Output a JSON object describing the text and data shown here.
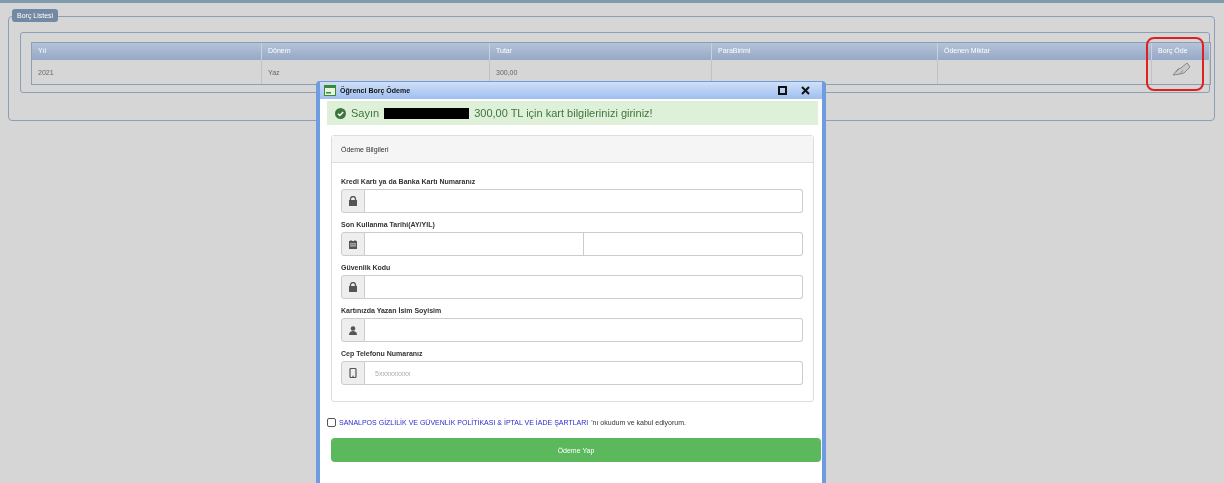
{
  "debt_list": {
    "legend": "Borç Listesi",
    "table": {
      "columns": [
        "Yıl",
        "Dönem",
        "Tutar",
        "ParaBirimi",
        "Ödenen Miktar",
        "Borç Öde"
      ],
      "rows": [
        {
          "cells": [
            "2021",
            "Yaz",
            "300,00",
            "",
            ""
          ],
          "highlighted": true
        }
      ]
    }
  },
  "dialog": {
    "title": "Öğrenci Borç Ödeme",
    "alert": {
      "greeting": "Sayın",
      "redacted": true,
      "message": "300,00 TL için kart bilgilerinizi giriniz!"
    },
    "panel_title": "Ödeme Bilgileri",
    "fields": [
      {
        "label": "Kredi Kartı ya da Banka Kartı Numaranız",
        "kind": "single"
      },
      {
        "label": "Son Kullanma Tarihi(AY/YIL)",
        "kind": "pair"
      },
      {
        "label": "Güvenlik Kodu",
        "kind": "single"
      },
      {
        "label": "Kartınızda Yazan İsim Soyisim",
        "kind": "single"
      },
      {
        "label": "Cep Telefonu Numaranız",
        "kind": "single",
        "placeholder": "5xxxxxxxxx"
      }
    ],
    "agreement": {
      "checked": false,
      "link": "SANALPOS GİZLİLİK VE GÜVENLİK POLİTİKASI & İPTAL VE İADE ŞARTLARI",
      "text": "'nı okudum ve kabul ediyorum."
    },
    "submit": "Ödeme Yap"
  }
}
